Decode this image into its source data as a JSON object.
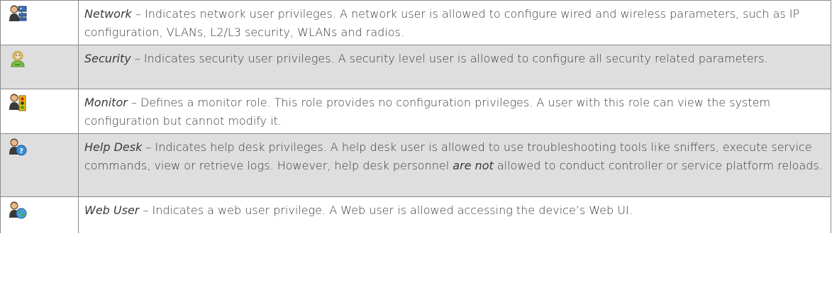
{
  "rows": [
    {
      "icon": "network-user-icon",
      "term": "Network",
      "desc_a": " – Indicates network user privileges. A network user is allowed to configure wired and wireless parameters, such as IP configuration, VLANs, L2/L3 security, WLANs and radios.",
      "emph": "",
      "desc_b": ""
    },
    {
      "icon": "security-user-icon",
      "term": "Security",
      "desc_a": " – Indicates security user privileges. A security level user is allowed to configure all security related parameters.",
      "emph": "",
      "desc_b": ""
    },
    {
      "icon": "monitor-user-icon",
      "term": "Monitor",
      "desc_a": " – Defines a monitor role. This role provides no configuration privileges. A user with this role can view the system configuration but cannot modify it.",
      "emph": "",
      "desc_b": ""
    },
    {
      "icon": "help-desk-user-icon",
      "term": "Help Desk",
      "desc_a": " – Indicates help desk privileges. A help desk user is allowed to use troubleshooting tools like sniffers, execute service commands, view or retrieve logs. However, help desk personnel ",
      "emph": "are not",
      "desc_b": " allowed to conduct controller or service platform reloads."
    },
    {
      "icon": "web-user-icon",
      "term": "Web User",
      "desc_a": " – Indicates a web user privilege. A Web user is allowed accessing the device’s Web UI.",
      "emph": "",
      "desc_b": ""
    }
  ],
  "colors": {
    "border": "#8a8a8a",
    "shaded_row": "#dedede",
    "text": "#3a3a3a"
  }
}
